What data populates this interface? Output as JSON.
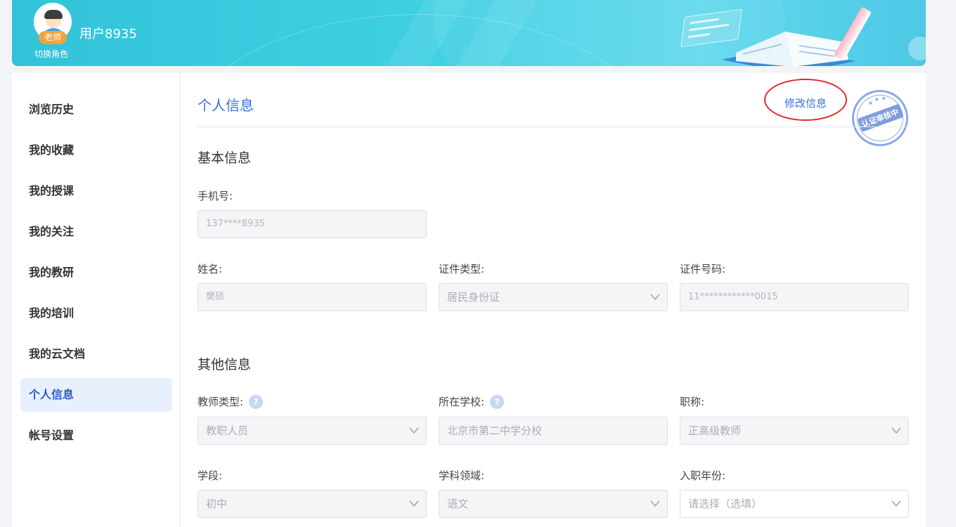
{
  "header": {
    "username": "用户8935",
    "role_badge": "老师",
    "switch_role": "切换角色"
  },
  "sidebar": {
    "items": [
      {
        "label": "浏览历史"
      },
      {
        "label": "我的收藏"
      },
      {
        "label": "我的授课"
      },
      {
        "label": "我的关注"
      },
      {
        "label": "我的教研"
      },
      {
        "label": "我的培训"
      },
      {
        "label": "我的云文档"
      },
      {
        "label": "个人信息"
      },
      {
        "label": "帐号设置"
      }
    ],
    "active_index": 7
  },
  "main": {
    "title": "个人信息",
    "edit_link": "修改信息",
    "stamp_text": "认证审核中",
    "basic_section": "基本信息",
    "other_section": "其他信息",
    "fields": {
      "phone": {
        "label": "手机号:",
        "value": "137****8935"
      },
      "name": {
        "label": "姓名:",
        "value": "樊硕"
      },
      "id_type": {
        "label": "证件类型:",
        "value": "居民身份证"
      },
      "id_number": {
        "label": "证件号码:",
        "value": "11************0015"
      },
      "teacher_type": {
        "label": "教师类型:",
        "value": "教职人员"
      },
      "school": {
        "label": "所在学校:",
        "value": "北京市第二中学分校"
      },
      "title": {
        "label": "职称:",
        "value": "正高级教师"
      },
      "stage": {
        "label": "学段:",
        "value": "初中"
      },
      "subject": {
        "label": "学科领域:",
        "value": "语文"
      },
      "entry_year": {
        "label": "入职年份:",
        "placeholder": "请选择（选填）"
      }
    }
  },
  "colors": {
    "accent": "#3a6fd8",
    "active_bg": "#e8f0fd",
    "banner": "#3fd0e3",
    "badge": "#f3a33b",
    "annotation": "#e22a2a"
  }
}
